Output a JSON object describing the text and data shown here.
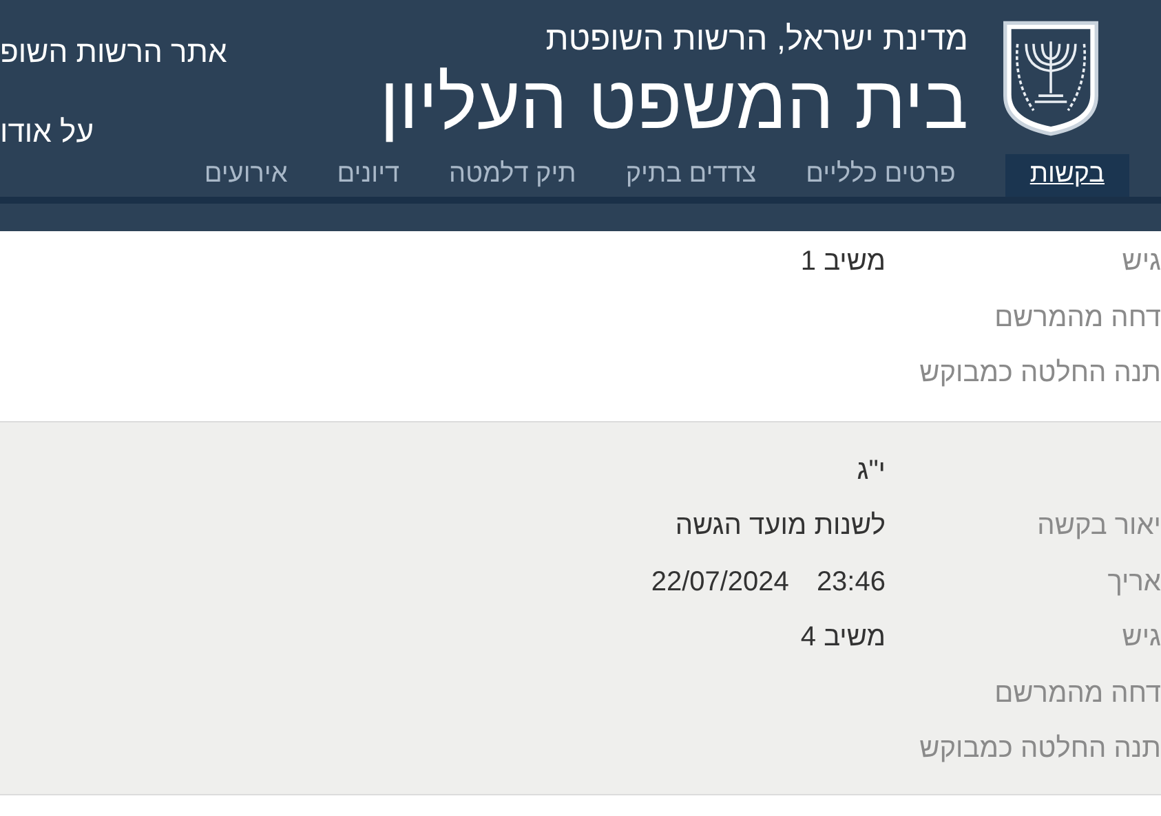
{
  "header": {
    "subtitle": "מדינת ישראל, הרשות השופטת",
    "title": "בית המשפט העליון",
    "links": [
      "אתר הרשות השופ",
      "על אודו"
    ]
  },
  "tabs": [
    {
      "label": "בקשות",
      "selected": true
    },
    {
      "label": "פרטים כלליים",
      "selected": false
    },
    {
      "label": "צדדים בתיק",
      "selected": false
    },
    {
      "label": "תיק דלמטה",
      "selected": false
    },
    {
      "label": "דיונים",
      "selected": false
    },
    {
      "label": "אירועים",
      "selected": false
    }
  ],
  "requests": [
    {
      "shaded": false,
      "rows": [
        {
          "label": "גיש",
          "value": "משיב 1"
        },
        {
          "label": "דחה מהמרשם",
          "value": ""
        },
        {
          "label": "תנה החלטה כמבוקש",
          "value": ""
        }
      ]
    },
    {
      "shaded": true,
      "rows": [
        {
          "label": "",
          "value": "י\"ג"
        },
        {
          "label": "יאור בקשה",
          "value": "לשנות מועד הגשה"
        },
        {
          "label": "אריך",
          "value": "23:46",
          "value_2": "22/07/2024"
        },
        {
          "label": "גיש",
          "value": "משיב 4"
        },
        {
          "label": "דחה מהמרשם",
          "value": ""
        },
        {
          "label": "תנה החלטה כמבוקש",
          "value": ""
        }
      ]
    }
  ]
}
